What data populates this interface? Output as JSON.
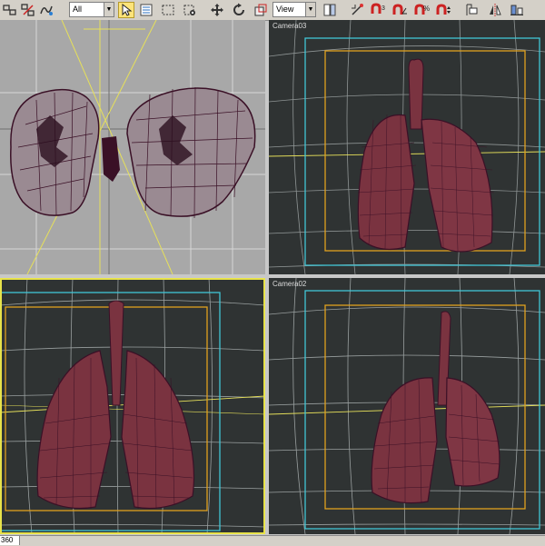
{
  "toolbar": {
    "selection_filter": "All",
    "reference_coord": "View",
    "icons": [
      "link-icon",
      "unlink-icon",
      "bind-space-warp-icon",
      "select-filter-dropdown",
      "select-object-icon",
      "select-by-name-icon",
      "rect-selection-region-icon",
      "window-crossing-icon",
      "select-and-move-icon",
      "select-and-rotate-icon",
      "select-and-scale-icon",
      "reference-coord-dropdown",
      "use-pivot-center-icon",
      "select-and-manipulate-icon",
      "snap-3d-icon",
      "angle-snap-icon",
      "percent-snap-icon",
      "spinner-snap-icon",
      "named-selection-icon",
      "mirror-icon",
      "align-icon"
    ]
  },
  "viewports": {
    "top_left": {
      "label": ""
    },
    "top_right": {
      "label": "Camera03"
    },
    "bottom_left": {
      "label": ""
    },
    "bottom_right": {
      "label": "Camera02"
    }
  },
  "status": {
    "frame": "360"
  },
  "colors": {
    "ortho_bg": "#a8a8a8",
    "camera_bg": "#2f3333",
    "grid_line": "#d8d8d8",
    "safe_frame_outer": "#41c6d6",
    "safe_frame_inner": "#e0a11e",
    "mesh_fill": "#7a3340",
    "wire_color": "#3a1026",
    "active_border": "#e8e34a",
    "axis_guides": "#e6e05a"
  }
}
